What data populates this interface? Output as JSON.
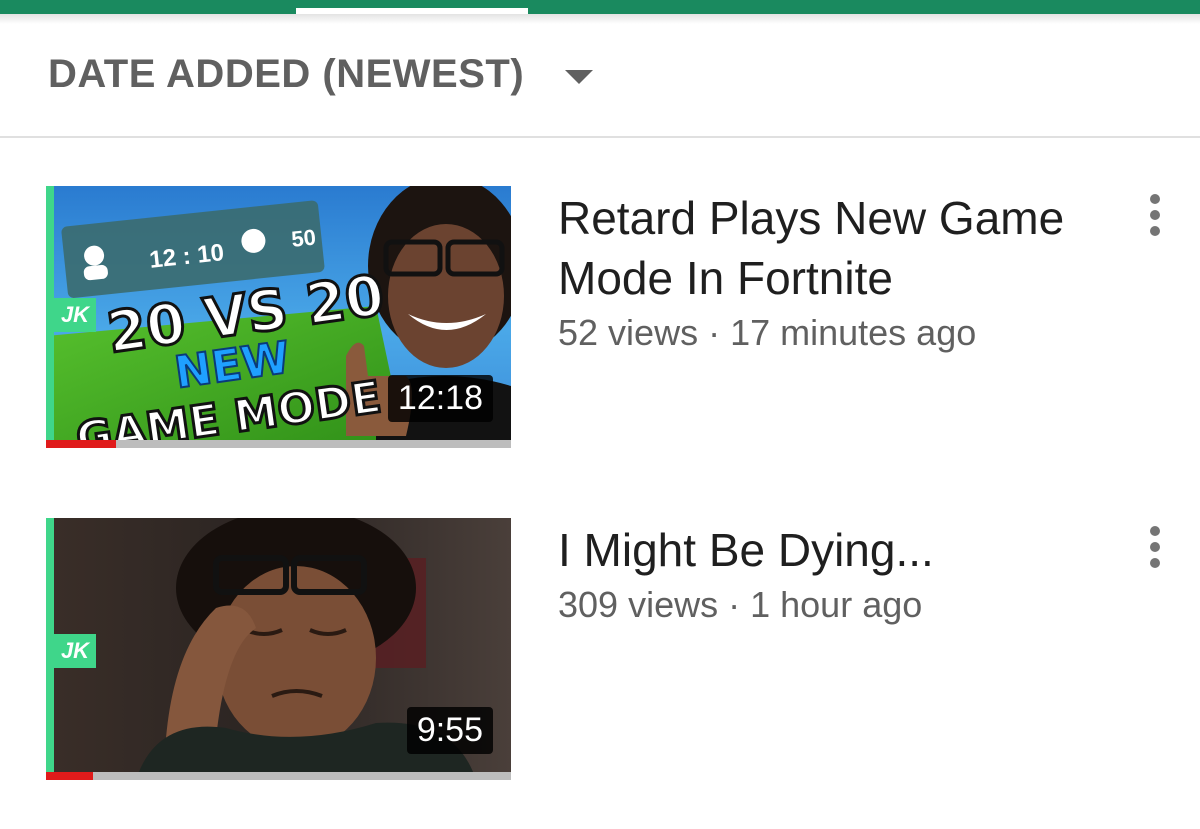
{
  "sort": {
    "label": "DATE ADDED (NEWEST)"
  },
  "videos": [
    {
      "title": "Retard Plays New Game Mode In Fortnite",
      "views": "52 views",
      "age": "17 minutes ago",
      "duration": "12:18",
      "progress": 0.15,
      "thumb_text": {
        "score_left": "12 : 10",
        "score_right": "50",
        "line1": "20 VS 20",
        "line2": "NEW",
        "line3": "GAME MODE",
        "logo": "JK"
      }
    },
    {
      "title": "I Might Be Dying...",
      "views": "309 views",
      "age": "1 hour ago",
      "duration": "9:55",
      "progress": 0.1,
      "thumb_text": {
        "logo": "JK"
      }
    }
  ],
  "colors": {
    "accent": "#1a8a5f",
    "progress": "#e01b1b",
    "thumb_accent": "#3fd68a"
  }
}
